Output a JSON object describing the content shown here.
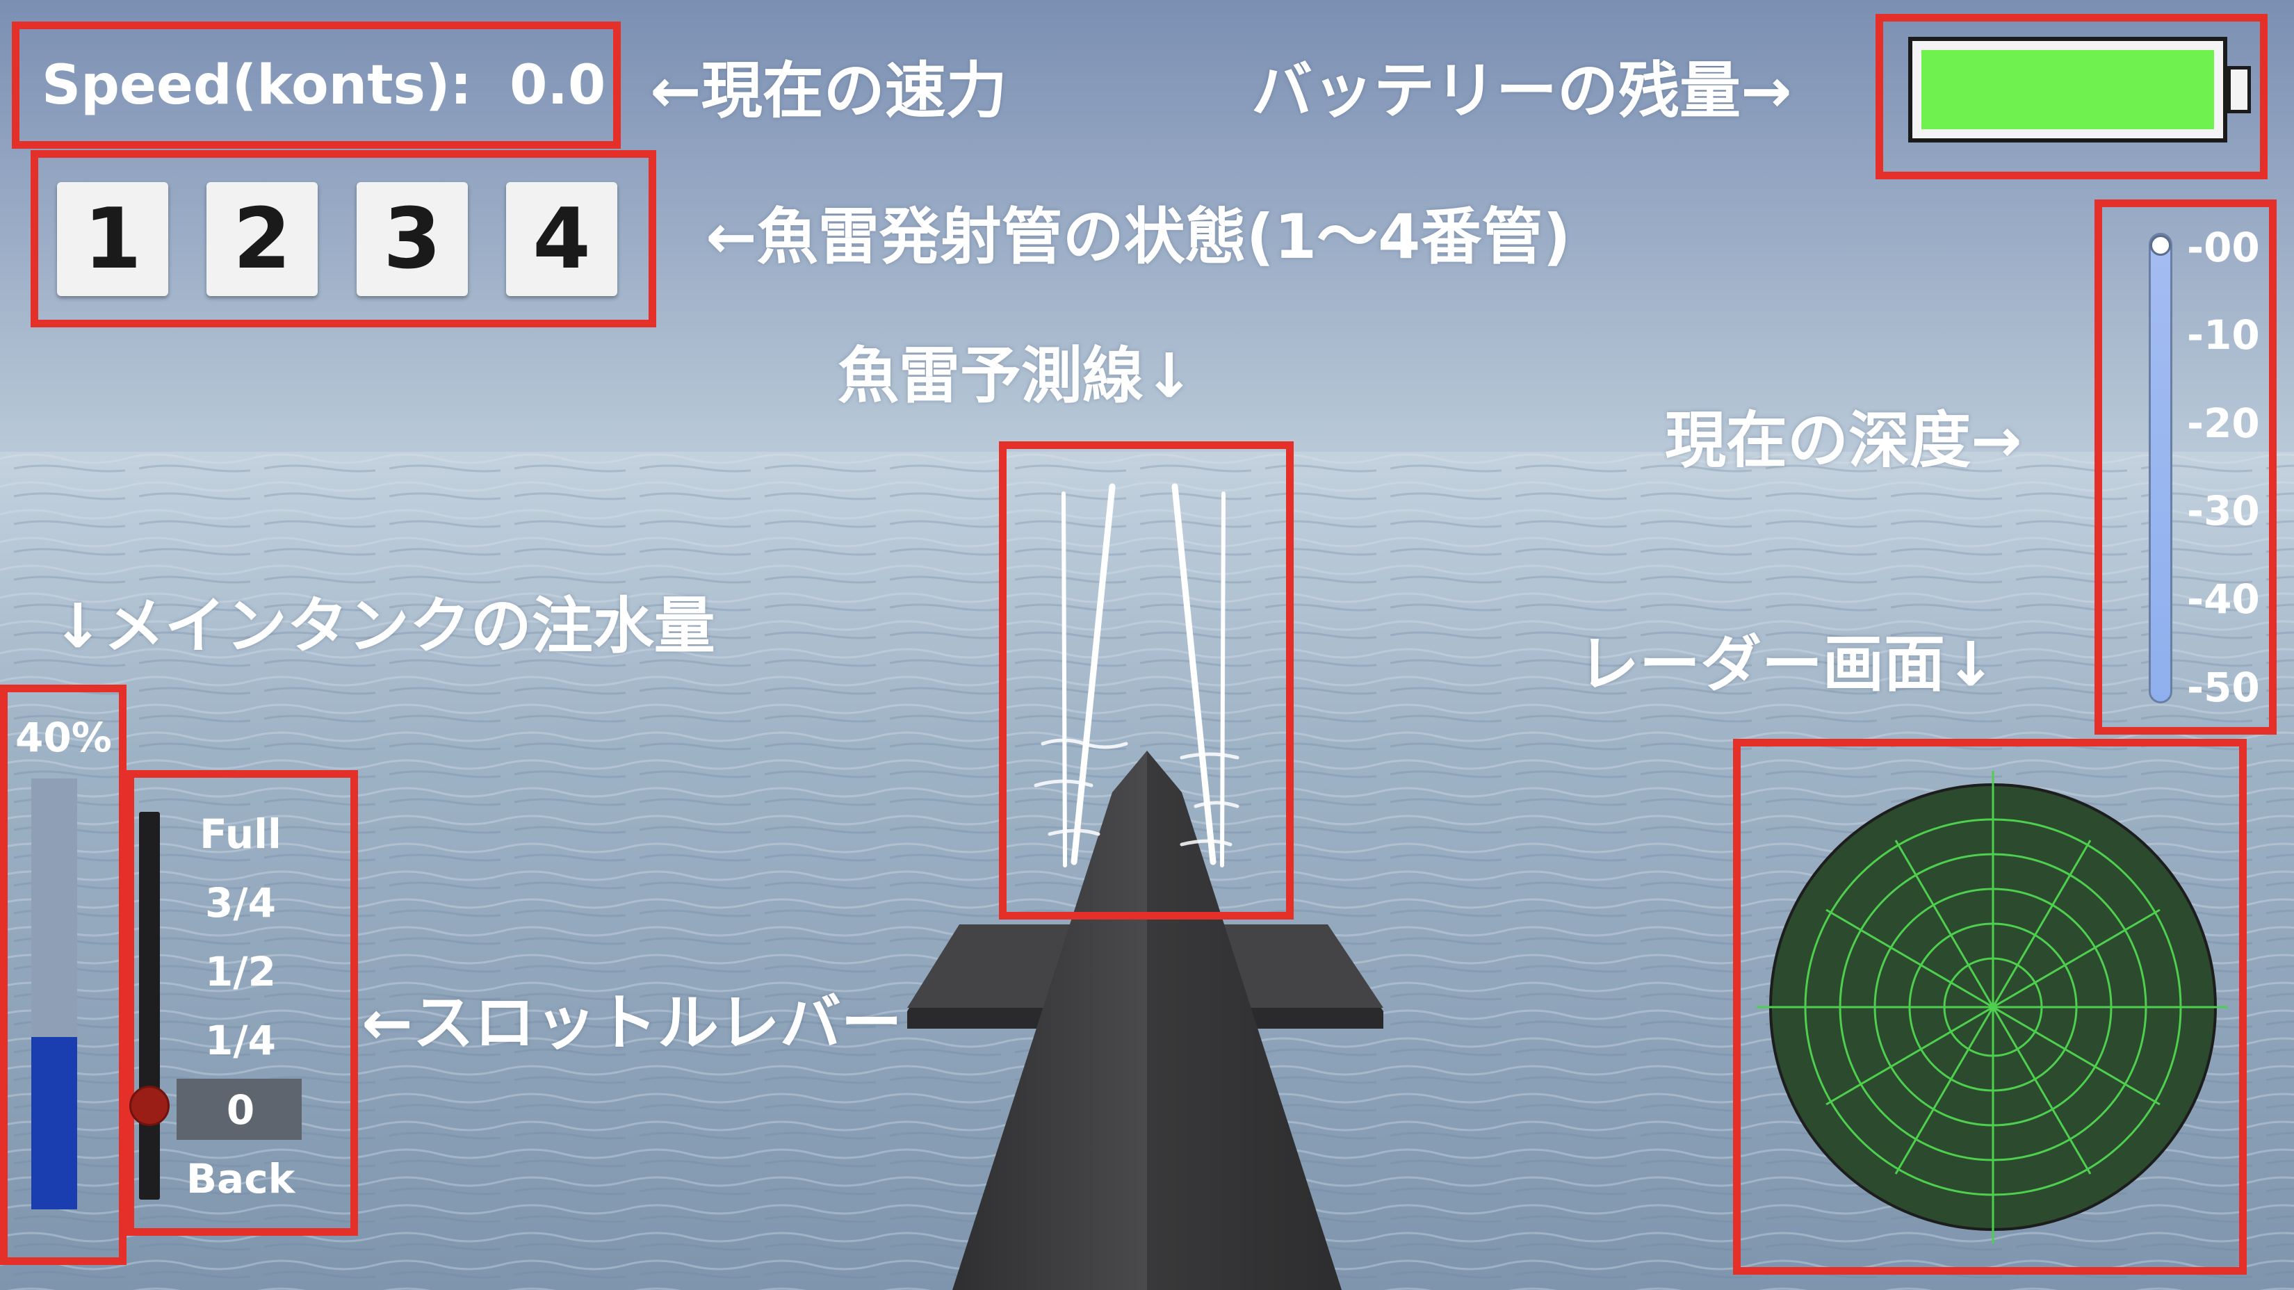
{
  "hud": {
    "speed_label": "Speed(konts):",
    "speed_value": "0.0",
    "torpedo_tubes": [
      "1",
      "2",
      "3",
      "4"
    ],
    "battery_level": 1.0,
    "battery_color": "#6ff24f",
    "depth_scale": [
      "-00",
      "-10",
      "-20",
      "-30",
      "-40",
      "-50"
    ],
    "depth_value": 0,
    "main_tank_percent_label": "40%",
    "main_tank_fill": 0.4,
    "main_tank_color": "#1a3eb0",
    "throttle_options": [
      "Full",
      "3/4",
      "1/2",
      "1/4",
      "0",
      "Back"
    ],
    "throttle_selected": "0",
    "radar_color": "#2b4a2e",
    "radar_line_color": "#4ed04e"
  },
  "annotations": {
    "speed": "←現在の速力",
    "battery": "バッテリーの残量→",
    "tubes": "←魚雷発射管の状態(1〜4番管)",
    "prediction": "魚雷予測線↓",
    "depth": "現在の深度→",
    "tank": "↓メインタンクの注水量",
    "radar": "レーダー画面↓",
    "throttle": "←スロットルレバー"
  },
  "colors": {
    "annotation_box": "#e5302a",
    "sky": "#7f93b5",
    "sea": "#8ea5bd",
    "hull": "#3f3f41"
  }
}
